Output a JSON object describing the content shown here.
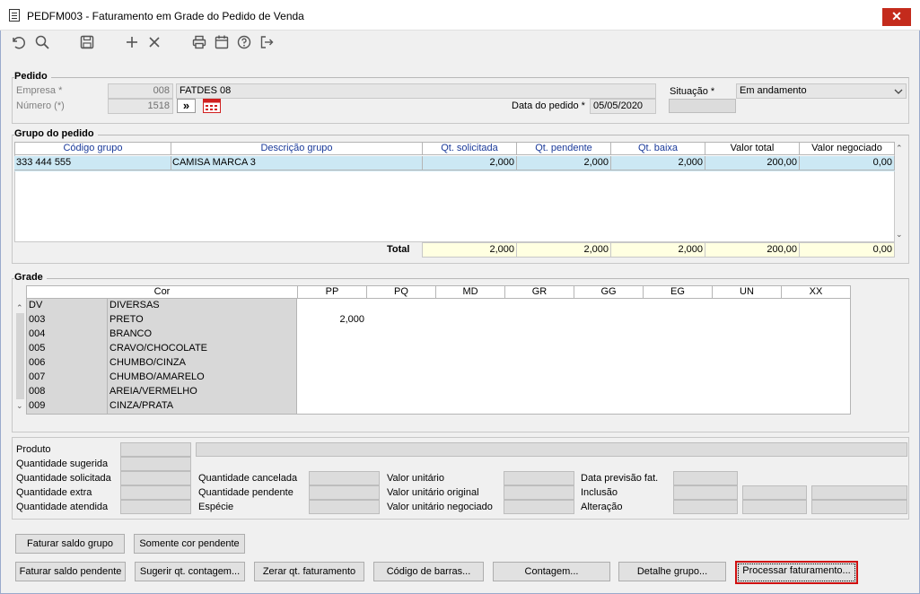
{
  "window": {
    "title": "PEDFM003 - Faturamento em Grade do Pedido de Venda",
    "close_icon": "✕"
  },
  "toolbar": {
    "icons": [
      "undo-icon",
      "search-icon",
      "save-icon",
      "add-icon",
      "delete-icon",
      "print-icon",
      "calendar-icon",
      "help-icon",
      "exit-icon"
    ]
  },
  "pedido": {
    "title": "Pedido",
    "empresa_label": "Empresa *",
    "empresa_code": "008",
    "empresa_name": "FATDES 08",
    "numero_label": "Número (*)",
    "numero_value": "1518",
    "go_label": "»",
    "data_label": "Data do pedido *",
    "data_value": "05/05/2020",
    "situacao_label": "Situação *",
    "situacao_value": "Em andamento"
  },
  "grupo": {
    "title": "Grupo do pedido",
    "columns": [
      "Código grupo",
      "Descrição grupo",
      "Qt. solicitada",
      "Qt. pendente",
      "Qt. baixa",
      "Valor total",
      "Valor  negociado"
    ],
    "rows": [
      [
        "333 444 555",
        "CAMISA MARCA 3",
        "2,000",
        "2,000",
        "2,000",
        "200,00",
        "0,00"
      ]
    ],
    "total_label": "Total",
    "totals": [
      "2,000",
      "2,000",
      "2,000",
      "200,00",
      "0,00"
    ]
  },
  "grade": {
    "title": "Grade",
    "cor_header": "Cor",
    "sizes": [
      "PP",
      "PQ",
      "MD",
      "GR",
      "GG",
      "EG",
      "UN",
      "XX"
    ],
    "rows": [
      {
        "code": "DV",
        "name": "DIVERSAS",
        "pp": ""
      },
      {
        "code": "003",
        "name": "PRETO",
        "pp": "2,000"
      },
      {
        "code": "004",
        "name": "BRANCO",
        "pp": ""
      },
      {
        "code": "005",
        "name": "CRAVO/CHOCOLATE",
        "pp": ""
      },
      {
        "code": "006",
        "name": "CHUMBO/CINZA",
        "pp": ""
      },
      {
        "code": "007",
        "name": "CHUMBO/AMARELO",
        "pp": ""
      },
      {
        "code": "008",
        "name": "AREIA/VERMELHO",
        "pp": ""
      },
      {
        "code": "009",
        "name": "CINZA/PRATA",
        "pp": ""
      }
    ]
  },
  "produto": {
    "produto_label": "Produto",
    "qt_sugerida": "Quantidade sugerida",
    "qt_solicitada": "Quantidade solicitada",
    "qt_extra": "Quantidade extra",
    "qt_atendida": "Quantidade atendida",
    "qt_cancelada": "Quantidade cancelada",
    "qt_pendente": "Quantidade pendente",
    "especie": "Espécie",
    "valor_unitario": "Valor unitário",
    "valor_unitario_original": "Valor unitário original",
    "valor_unitario_negociado": "Valor unitário negociado",
    "data_previsao": "Data previsão fat.",
    "inclusao": "Inclusão",
    "alteracao": "Alteração"
  },
  "buttons": {
    "faturar_saldo_grupo": "Faturar saldo grupo",
    "somente_cor_pendente": "Somente cor pendente",
    "faturar_saldo_pendente": "Faturar saldo pendente",
    "sugerir_qt_contagem": "Sugerir qt. contagem...",
    "zerar_qt_faturamento": "Zerar qt. faturamento",
    "codigo_de_barras": "Código de barras...",
    "contagem": "Contagem...",
    "detalhe_grupo": "Detalhe grupo...",
    "processar_faturamento": "Processar faturamento..."
  },
  "colors": {
    "selected_row": "#cce8f4",
    "total_bg": "#ffffe1",
    "focus_border": "#d01010"
  }
}
